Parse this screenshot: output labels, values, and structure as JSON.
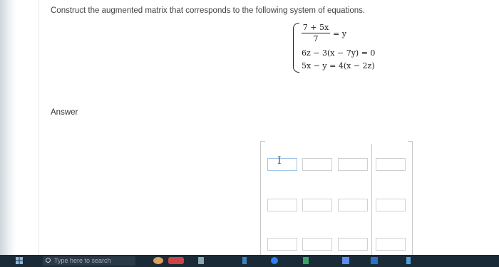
{
  "question": {
    "prompt": "Construct the augmented matrix that corresponds to the following system of equations.",
    "equations": {
      "eq1_numerator": "7 + 5x",
      "eq1_denominator": "7",
      "eq1_rhs": "= y",
      "eq2": "6z − 3(x − 7y) = 0",
      "eq3": "5x − y = 4(x − 2z)"
    }
  },
  "answer": {
    "label": "Answer",
    "matrix": {
      "rows": 3,
      "cols": 4,
      "values": [
        [
          "",
          "",
          "",
          ""
        ],
        [
          "",
          "",
          "",
          ""
        ],
        [
          "",
          "",
          "",
          ""
        ]
      ]
    }
  },
  "taskbar": {
    "search_placeholder": "Type here to search"
  },
  "colors": {
    "taskbar": "#1b2a37",
    "active_cell_border": "#9ec4e8"
  }
}
